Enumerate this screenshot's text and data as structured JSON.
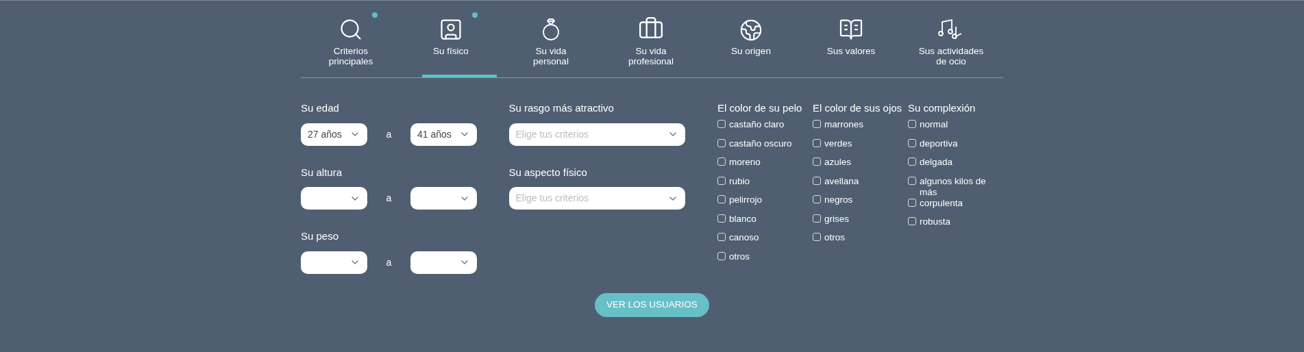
{
  "tabs": [
    {
      "label": "Criterios principales",
      "selected": false,
      "dot": true
    },
    {
      "label": "Su físico",
      "selected": true,
      "dot": true
    },
    {
      "label": "Su vida personal",
      "selected": false,
      "dot": false
    },
    {
      "label": "Su vida profesional",
      "selected": false,
      "dot": false
    },
    {
      "label": "Su origen",
      "selected": false,
      "dot": false
    },
    {
      "label": "Sus valores",
      "selected": false,
      "dot": false
    },
    {
      "label": "Sus actividades de ocio",
      "selected": false,
      "dot": false
    }
  ],
  "ranges": [
    {
      "label": "Su edad",
      "from": {
        "value": "27 años"
      },
      "separator": "a",
      "to": {
        "value": "41 años"
      }
    },
    {
      "label": "Su altura",
      "separator": "a"
    },
    {
      "label": "Su peso",
      "separator": "a"
    }
  ],
  "selects": [
    {
      "label": "Su rasgo más atractivo",
      "placeholder": "Elige tus criterios"
    },
    {
      "label": "Su aspecto físico",
      "placeholder": "Elige tus criterios"
    }
  ],
  "checkgroups": [
    {
      "title": "El color de su pelo",
      "options": [
        {
          "label": "castaño claro",
          "checked": false
        },
        {
          "label": "castaño oscuro",
          "checked": false
        },
        {
          "label": "moreno",
          "checked": false
        },
        {
          "label": "rubio",
          "checked": false
        },
        {
          "label": "pelirrojo",
          "checked": false
        },
        {
          "label": "blanco",
          "checked": false
        },
        {
          "label": "canoso",
          "checked": false
        },
        {
          "label": "otros",
          "checked": false
        }
      ]
    },
    {
      "title": "El color de sus ojos",
      "options": [
        {
          "label": "marrones",
          "checked": false
        },
        {
          "label": "verdes",
          "checked": false
        },
        {
          "label": "azules",
          "checked": false
        },
        {
          "label": "avellana",
          "checked": false
        },
        {
          "label": "negros",
          "checked": false
        },
        {
          "label": "grises",
          "checked": false
        },
        {
          "label": "otros",
          "checked": false
        }
      ]
    },
    {
      "title": "Su complexión",
      "options": [
        {
          "label": "normal",
          "checked": false
        },
        {
          "label": "deportiva",
          "checked": false
        },
        {
          "label": "delgada",
          "checked": false
        },
        {
          "label": "algunos kilos de más",
          "checked": false
        },
        {
          "label": "corpulenta",
          "checked": false
        },
        {
          "label": "robusta",
          "checked": false
        }
      ]
    }
  ],
  "submit": "VER LOS USUARIOS"
}
